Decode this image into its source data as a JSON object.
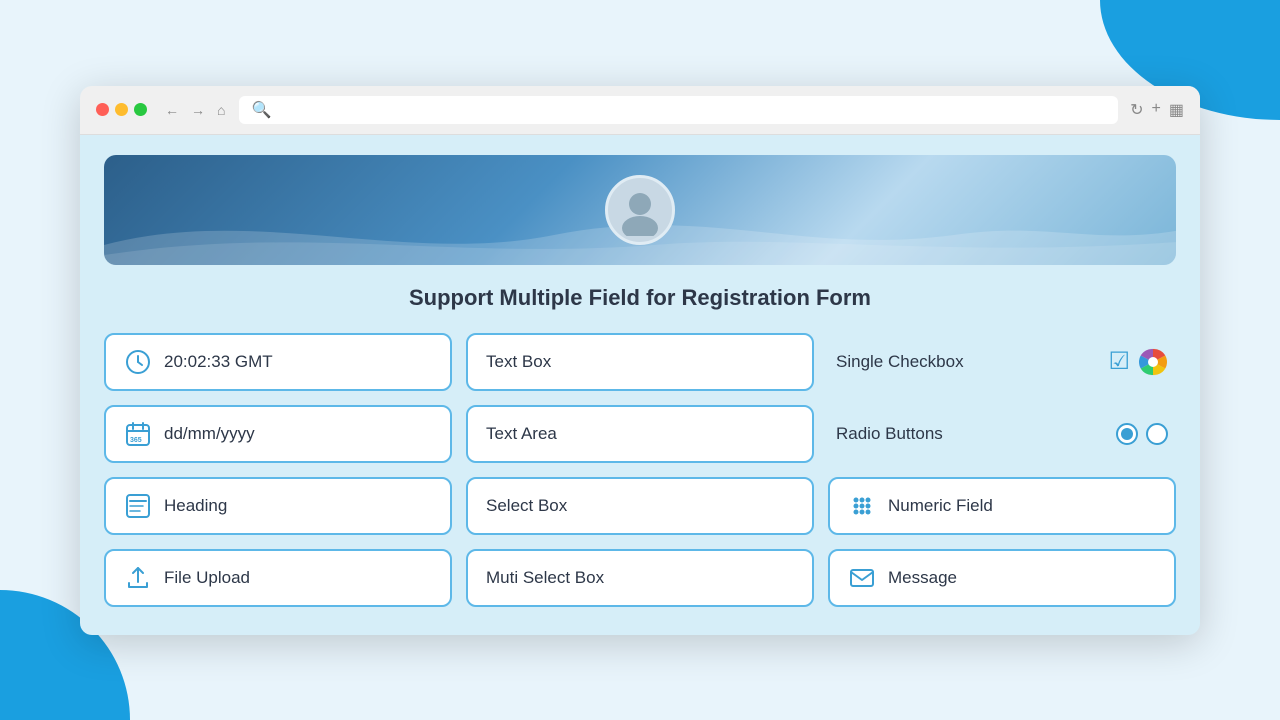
{
  "browser": {
    "traffic_lights": [
      "red",
      "yellow",
      "green"
    ],
    "url": "",
    "search_placeholder": "Search"
  },
  "header": {
    "title": "Support Multiple Field for Registration Form"
  },
  "fields": [
    {
      "id": "time",
      "label": "20:02:33 GMT",
      "icon": "clock",
      "col": 1
    },
    {
      "id": "text-box",
      "label": "Text Box",
      "icon": "none",
      "col": 2
    },
    {
      "id": "single-checkbox",
      "label": "Single Checkbox",
      "icon": "checkbox",
      "col": 3
    },
    {
      "id": "date",
      "label": "dd/mm/yyyy",
      "icon": "calendar",
      "col": 1
    },
    {
      "id": "text-area",
      "label": "Text Area",
      "icon": "none",
      "col": 2
    },
    {
      "id": "radio-buttons",
      "label": "Radio Buttons",
      "icon": "radio",
      "col": 3
    },
    {
      "id": "heading",
      "label": "Heading",
      "icon": "heading",
      "col": 1
    },
    {
      "id": "select-box",
      "label": "Select Box",
      "icon": "none",
      "col": 2
    },
    {
      "id": "numeric-field",
      "label": "Numeric Field",
      "icon": "grid",
      "col": 3
    },
    {
      "id": "file-upload",
      "label": "File Upload",
      "icon": "upload",
      "col": 1
    },
    {
      "id": "multi-select",
      "label": "Muti Select Box",
      "icon": "none",
      "col": 2
    },
    {
      "id": "message",
      "label": "Message",
      "icon": "envelope",
      "col": 3
    }
  ]
}
